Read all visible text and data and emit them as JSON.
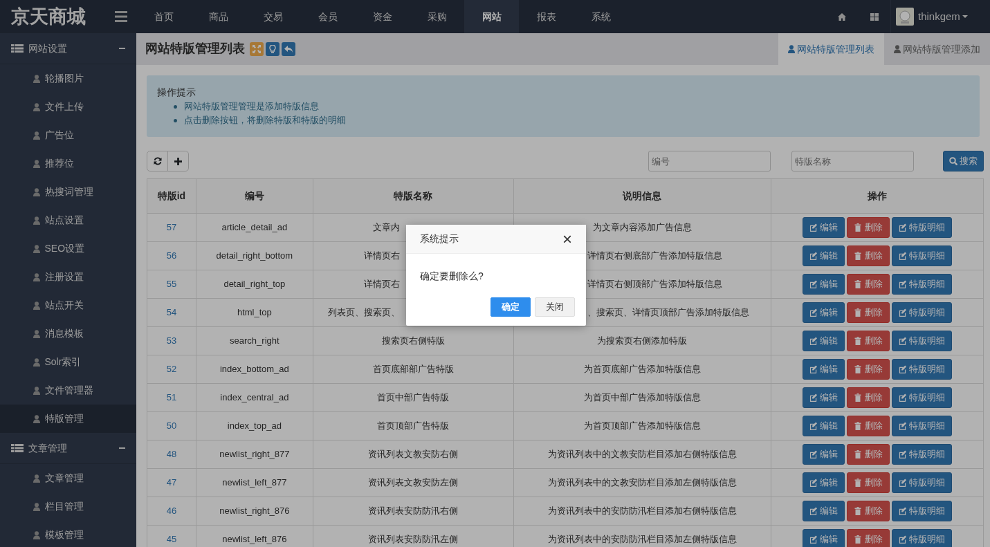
{
  "brand": "京天商城",
  "nav": [
    {
      "label": "首页",
      "selected": false
    },
    {
      "label": "商品",
      "selected": false
    },
    {
      "label": "交易",
      "selected": false
    },
    {
      "label": "会员",
      "selected": false
    },
    {
      "label": "资金",
      "selected": false
    },
    {
      "label": "采购",
      "selected": false
    },
    {
      "label": "网站",
      "selected": true
    },
    {
      "label": "报表",
      "selected": false
    },
    {
      "label": "系统",
      "selected": false
    }
  ],
  "user": {
    "name": "thinkgem"
  },
  "sidebar": [
    {
      "label": "网站设置",
      "expanded": true,
      "children": [
        {
          "label": "轮播图片",
          "selected": false
        },
        {
          "label": "文件上传",
          "selected": false
        },
        {
          "label": "广告位",
          "selected": false
        },
        {
          "label": "推荐位",
          "selected": false
        },
        {
          "label": "热搜词管理",
          "selected": false
        },
        {
          "label": "站点设置",
          "selected": false
        },
        {
          "label": "SEO设置",
          "selected": false
        },
        {
          "label": "注册设置",
          "selected": false
        },
        {
          "label": "站点开关",
          "selected": false
        },
        {
          "label": "消息模板",
          "selected": false
        },
        {
          "label": "Solr索引",
          "selected": false
        },
        {
          "label": "文件管理器",
          "selected": false
        },
        {
          "label": "特版管理",
          "selected": true
        }
      ]
    },
    {
      "label": "文章管理",
      "expanded": true,
      "children": [
        {
          "label": "文章管理",
          "selected": false
        },
        {
          "label": "栏目管理",
          "selected": false
        },
        {
          "label": "模板管理",
          "selected": false
        }
      ]
    }
  ],
  "page": {
    "title": "网站特版管理列表",
    "tabs": [
      {
        "label": "网站特版管理列表",
        "selected": true
      },
      {
        "label": "网站特版管理添加",
        "selected": false
      }
    ]
  },
  "tips": {
    "title": "操作提示",
    "items": [
      "网站特版管理管理是添加特版信息",
      "点击删除按钮，将删除特版和特版的明细"
    ]
  },
  "search": {
    "fields": [
      {
        "placeholder": "编号"
      },
      {
        "placeholder": "特版名称"
      }
    ],
    "button": "搜索"
  },
  "table": {
    "columns": [
      "特版id",
      "编号",
      "特版名称",
      "说明信息",
      "操作"
    ],
    "rows": [
      {
        "id": "57",
        "code": "article_detail_ad",
        "name": "文章内",
        "name_hidden_part": true,
        "desc": "为文章内容添加广告信息",
        "actions": [
          "编辑",
          "删除",
          "特版明细"
        ]
      },
      {
        "id": "56",
        "code": "detail_right_bottom",
        "name": "详情页右",
        "name_hidden_part": true,
        "desc": "详情页右侧底部广告添加特版信息",
        "desc_hidden_part": true,
        "actions": [
          "编辑",
          "删除",
          "特版明细"
        ]
      },
      {
        "id": "55",
        "code": "detail_right_top",
        "name": "详情页右",
        "name_hidden_part": true,
        "desc": "详情页右侧顶部广告添加特版信息",
        "desc_hidden_part": true,
        "actions": [
          "编辑",
          "删除",
          "特版明细"
        ]
      },
      {
        "id": "54",
        "code": "html_top",
        "name": "列表页、搜索页、",
        "name_hidden_part": true,
        "desc": "、搜索页、详情页顶部广告添加特版信息",
        "desc_hidden_part": true,
        "actions": [
          "编辑",
          "删除",
          "特版明细"
        ]
      },
      {
        "id": "53",
        "code": "search_right",
        "name": "搜索页右侧特版",
        "desc": "为搜索页右侧添加特版",
        "actions": [
          "编辑",
          "删除",
          "特版明细"
        ]
      },
      {
        "id": "52",
        "code": "index_bottom_ad",
        "name": "首页底部部广告特版",
        "desc": "为首页底部广告添加特版信息",
        "actions": [
          "编辑",
          "删除",
          "特版明细"
        ]
      },
      {
        "id": "51",
        "code": "index_central_ad",
        "name": "首页中部广告特版",
        "desc": "为首页中部广告添加特版信息",
        "actions": [
          "编辑",
          "删除",
          "特版明细"
        ]
      },
      {
        "id": "50",
        "code": "index_top_ad",
        "name": "首页顶部广告特版",
        "desc": "为首页顶部广告添加特版信息",
        "actions": [
          "编辑",
          "删除",
          "特版明细"
        ]
      },
      {
        "id": "48",
        "code": "newlist_right_877",
        "name": "资讯列表文教安防右侧",
        "desc": "为资讯列表中的文教安防栏目添加右侧特版信息",
        "actions": [
          "编辑",
          "删除",
          "特版明细"
        ]
      },
      {
        "id": "47",
        "code": "newlist_left_877",
        "name": "资讯列表文教安防左侧",
        "desc": "为资讯列表中的文教安防栏目添加左侧特版信息",
        "actions": [
          "编辑",
          "删除",
          "特版明细"
        ]
      },
      {
        "id": "46",
        "code": "newlist_right_876",
        "name": "资讯列表安防防汛右侧",
        "desc": "为资讯列表中的安防防汛栏目添加右侧特版信息",
        "actions": [
          "编辑",
          "删除",
          "特版明细"
        ]
      },
      {
        "id": "45",
        "code": "newlist_left_876",
        "name": "资讯列表安防防汛左侧",
        "desc": "为资讯列表中的安防防汛栏目添加左侧特版信息",
        "actions": [
          "编辑",
          "删除",
          "特版明细"
        ]
      }
    ]
  },
  "dialog": {
    "title": "系统提示",
    "close": "×",
    "message": "确定要删除么?",
    "buttons": [
      {
        "label": "确定",
        "kind": "primary"
      },
      {
        "label": "关闭",
        "kind": "secondary"
      }
    ]
  }
}
